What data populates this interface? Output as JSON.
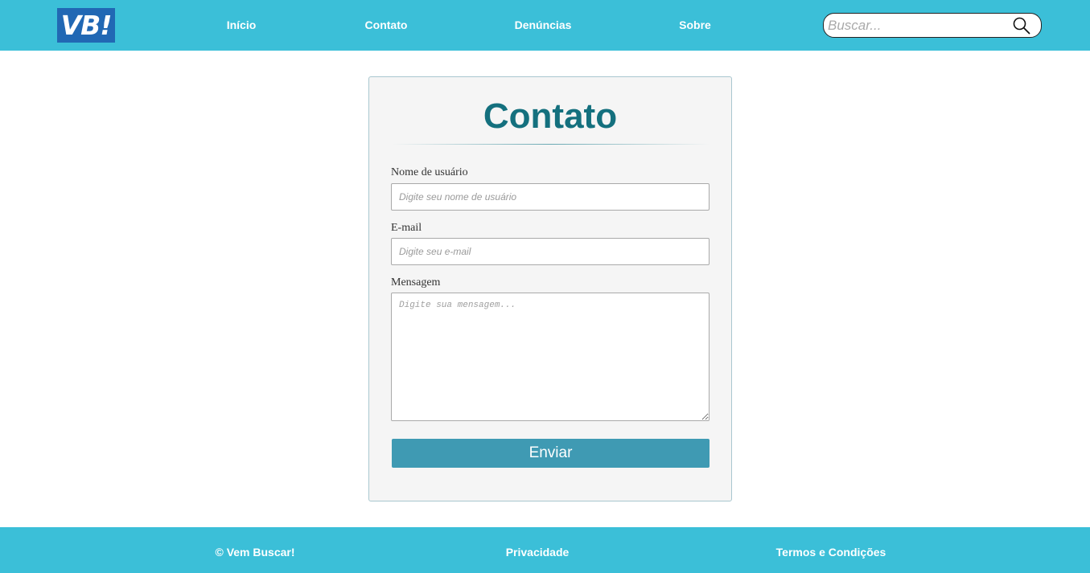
{
  "header": {
    "logo_text": "VB!",
    "nav": {
      "home": "Início",
      "contact": "Contato",
      "reports": "Denúncias",
      "about": "Sobre"
    },
    "search": {
      "placeholder": "Buscar...",
      "icon": "search-icon"
    }
  },
  "form": {
    "title": "Contato",
    "username": {
      "label": "Nome de usuário",
      "placeholder": "Digite seu nome de usuário",
      "value": ""
    },
    "email": {
      "label": "E-mail",
      "placeholder": "Digite seu e-mail",
      "value": ""
    },
    "message": {
      "label": "Mensagem",
      "placeholder": "Digite sua mensagem...",
      "value": ""
    },
    "submit_label": "Enviar"
  },
  "footer": {
    "copyright": "© Vem Buscar!",
    "privacy": "Privacidade",
    "terms": "Termos e Condições"
  },
  "colors": {
    "header_bg": "#3bbfd8",
    "logo_bg": "#2168b4",
    "title": "#14707e",
    "button": "#3f9ab3"
  }
}
